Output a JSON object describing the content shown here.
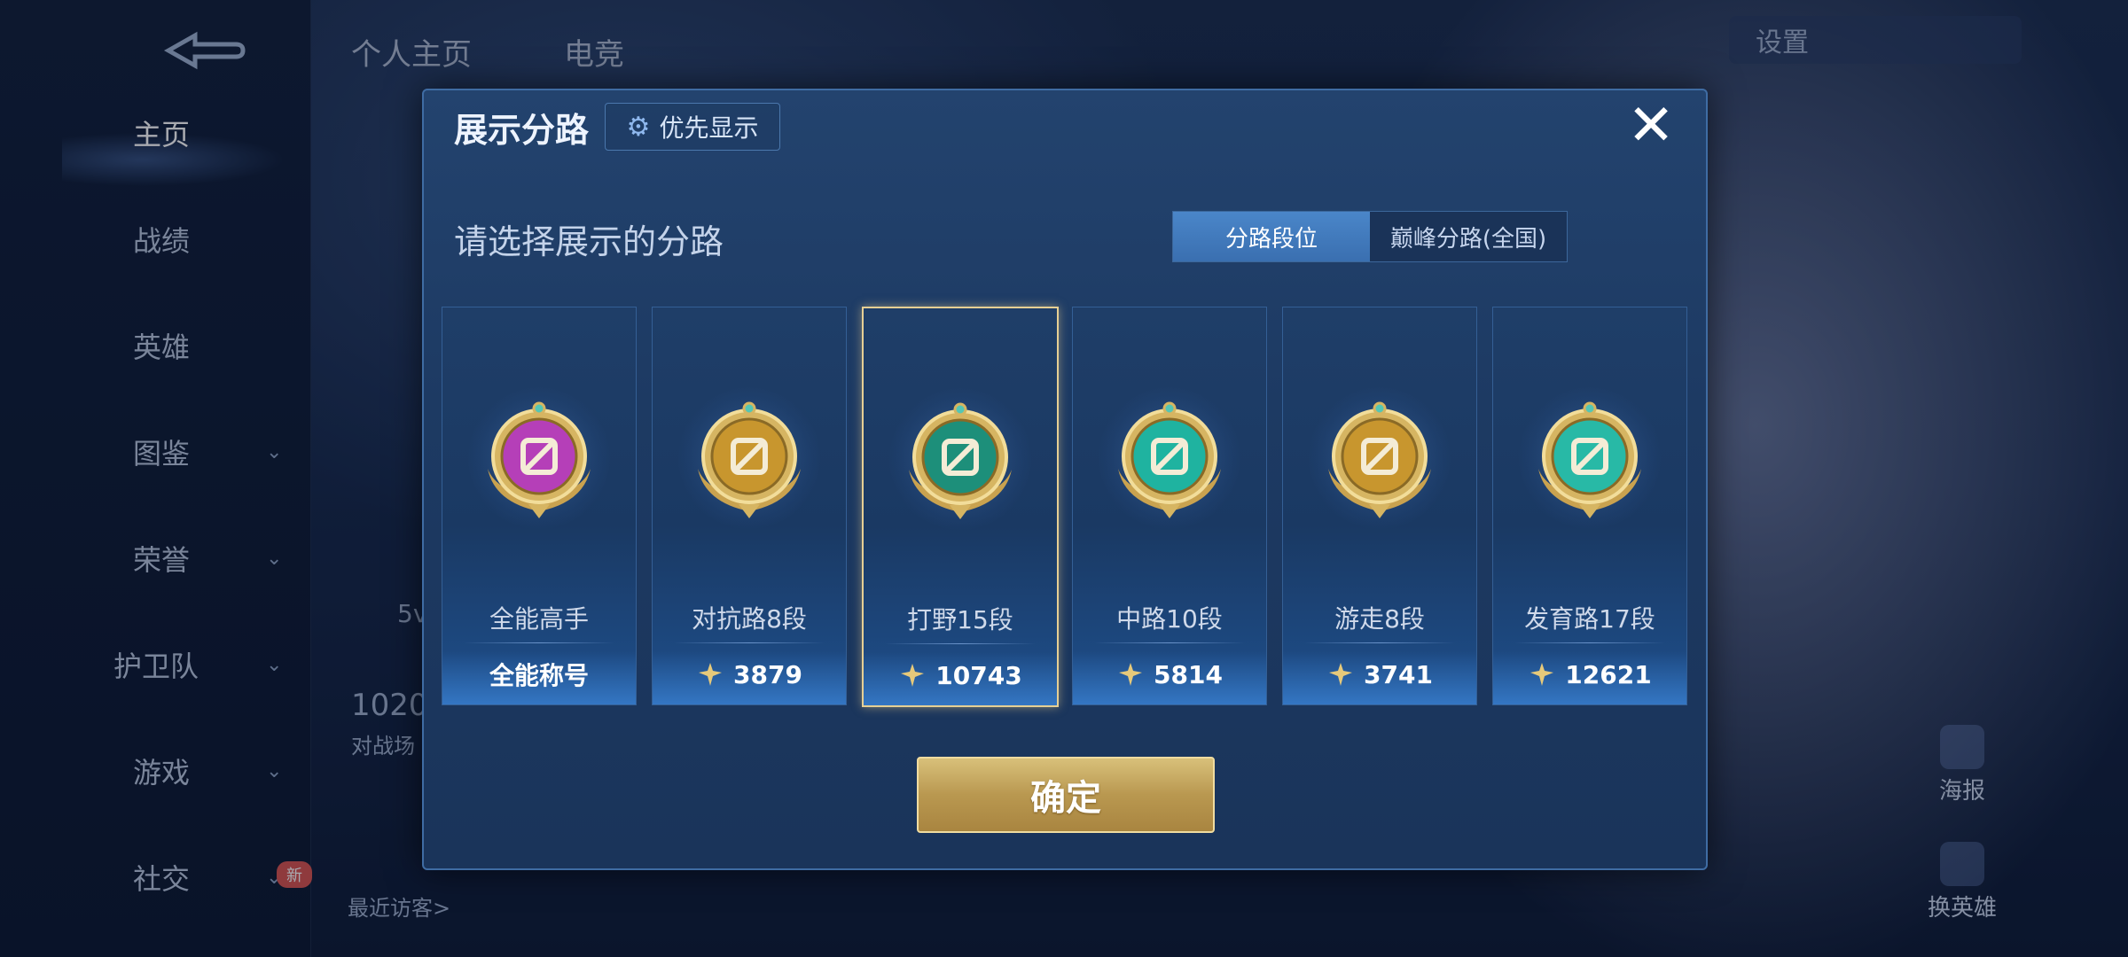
{
  "background": {
    "top_tabs": [
      "个人主页",
      "电竞"
    ],
    "settings_label": "设置",
    "sidebar": [
      {
        "label": "主页",
        "active": true,
        "has_chevron": false
      },
      {
        "label": "战绩",
        "active": false,
        "has_chevron": false
      },
      {
        "label": "英雄",
        "active": false,
        "has_chevron": false
      },
      {
        "label": "图鉴",
        "active": false,
        "has_chevron": true
      },
      {
        "label": "荣誉",
        "active": false,
        "has_chevron": true
      },
      {
        "label": "护卫队",
        "active": false,
        "has_chevron": true
      },
      {
        "label": "游戏",
        "active": false,
        "has_chevron": true
      },
      {
        "label": "社交",
        "active": false,
        "has_chevron": true
      }
    ],
    "new_badge": "新",
    "recent_visitors": "最近访客>",
    "side_text_1": "5v",
    "side_text_2": "1020",
    "side_text_3": "对战场",
    "right_buttons": [
      "海报",
      "换英雄"
    ]
  },
  "modal": {
    "title": "展示分路",
    "priority_button": "优先显示",
    "subtitle": "请选择展示的分路",
    "segment": {
      "options": [
        "分路段位",
        "巅峰分路(全国)"
      ],
      "selected": "分路段位"
    },
    "cards": [
      {
        "name": "全能高手",
        "value": "全能称号",
        "has_points_icon": false,
        "selected": false,
        "icon": "all-round-badge-icon",
        "color": "#b53fb8"
      },
      {
        "name": "对抗路8段",
        "value": "3879",
        "has_points_icon": true,
        "selected": false,
        "icon": "clash-lane-badge-icon",
        "color": "#c8962e"
      },
      {
        "name": "打野15段",
        "value": "10743",
        "has_points_icon": true,
        "selected": true,
        "icon": "jungle-badge-icon",
        "color": "#1d8f7a"
      },
      {
        "name": "中路10段",
        "value": "5814",
        "has_points_icon": true,
        "selected": false,
        "icon": "mid-lane-badge-icon",
        "color": "#1fb3a0"
      },
      {
        "name": "游走8段",
        "value": "3741",
        "has_points_icon": true,
        "selected": false,
        "icon": "roam-badge-icon",
        "color": "#c8962e"
      },
      {
        "name": "发育路17段",
        "value": "12621",
        "has_points_icon": true,
        "selected": false,
        "icon": "farm-lane-badge-icon",
        "color": "#28b9a6"
      }
    ],
    "confirm_button": "确定",
    "close_icon": "close-icon"
  }
}
